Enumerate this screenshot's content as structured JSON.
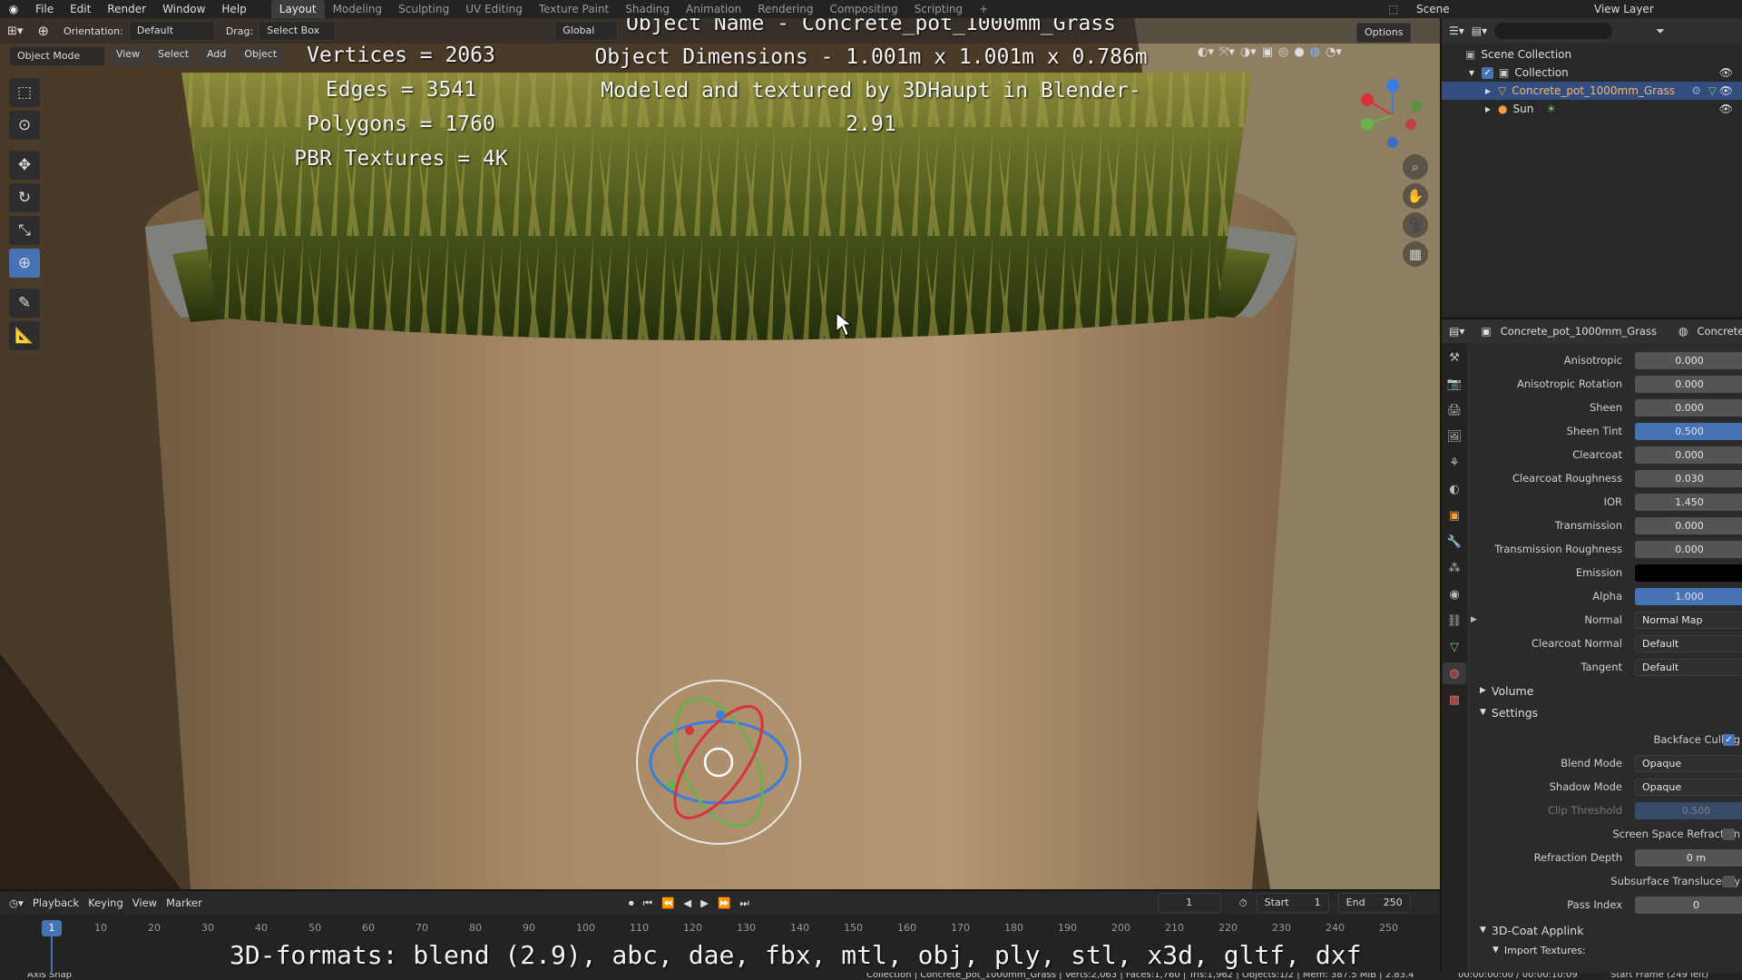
{
  "menu": [
    "File",
    "Edit",
    "Render",
    "Window",
    "Help"
  ],
  "workspaces": [
    "Layout",
    "Modeling",
    "Sculpting",
    "UV Editing",
    "Texture Paint",
    "Shading",
    "Animation",
    "Rendering",
    "Compositing",
    "Scripting"
  ],
  "scene": "Scene",
  "view_layer": "View Layer",
  "viewport": {
    "orientation_label": "Orientation:",
    "orientation": "Default",
    "drag_label": "Drag:",
    "drag": "Select Box",
    "transform": "Global",
    "options": "Options",
    "mode": "Object Mode",
    "view_menu": "View",
    "select_menu": "Select",
    "add_menu": "Add",
    "object_menu": "Object"
  },
  "overlay": {
    "stats": [
      "Vertices = 2063",
      "Edges = 3541",
      "Polygons = 1760",
      "PBR Textures = 4K"
    ],
    "name": "Object Name - Concrete_pot_1000mm_Grass",
    "dims": "Object Dimensions -  1.001m x 1.001m x 0.786m",
    "credit": "Modeled and textured by 3DHaupt in Blender-2.91",
    "formats": "3D-formats: blend (2.9), abc, dae, fbx, mtl, obj, ply, stl, x3d, gltf, dxf"
  },
  "outliner": {
    "root": "Scene Collection",
    "collection": "Collection",
    "object": "Concrete_pot_1000mm_Grass",
    "sun": "Sun"
  },
  "props": {
    "object": "Concrete_pot_1000mm_Grass",
    "material": "Concrete",
    "rows": [
      {
        "label": "Anisotropic",
        "value": "0.000"
      },
      {
        "label": "Anisotropic Rotation",
        "value": "0.000"
      },
      {
        "label": "Sheen",
        "value": "0.000"
      },
      {
        "label": "Sheen Tint",
        "value": "0.500",
        "fill": 0.5
      },
      {
        "label": "Clearcoat",
        "value": "0.000"
      },
      {
        "label": "Clearcoat Roughness",
        "value": "0.030",
        "fill": 0.03
      },
      {
        "label": "IOR",
        "value": "1.450"
      },
      {
        "label": "Transmission",
        "value": "0.000"
      },
      {
        "label": "Transmission Roughness",
        "value": "0.000"
      },
      {
        "label": "Emission",
        "value": ""
      },
      {
        "label": "Alpha",
        "value": "1.000",
        "fill": 1.0
      },
      {
        "label": "Normal",
        "value": "Normal Map"
      },
      {
        "label": "Clearcoat Normal",
        "value": "Default"
      },
      {
        "label": "Tangent",
        "value": "Default"
      }
    ],
    "volume": "Volume",
    "settings": "Settings",
    "backface_culling": "Backface Culling",
    "blend_mode_label": "Blend Mode",
    "blend_mode": "Opaque",
    "shadow_mode_label": "Shadow Mode",
    "shadow_mode": "Opaque",
    "clip_threshold_label": "Clip Threshold",
    "clip_threshold": "0.500",
    "ssr": "Screen Space Refraction",
    "refraction_depth_label": "Refraction Depth",
    "refraction_depth": "0 m",
    "sss": "Subsurface Translucency",
    "pass_index_label": "Pass Index",
    "pass_index": "0",
    "applink": "3D-Coat Applink",
    "import_textures": "Import Textures:"
  },
  "timeline": {
    "playback": "Playback",
    "keying": "Keying",
    "view": "View",
    "marker": "Marker",
    "current": "1",
    "start_label": "Start",
    "start": "1",
    "end_label": "End",
    "end": "250",
    "ticks": [
      "10",
      "20",
      "30",
      "40",
      "50",
      "60",
      "70",
      "80",
      "90",
      "100",
      "110",
      "120",
      "130",
      "140",
      "150",
      "160",
      "170",
      "180",
      "190",
      "200",
      "210",
      "220",
      "230",
      "240",
      "250"
    ]
  },
  "status": {
    "left": "Axis Snap",
    "stats": "Collection | Concrete_pot_1000mm_Grass | Verts:2,063 | Faces:1,760 | Tris:1,962 | Objects:1/2 | Mem: 387.5 MiB | 2.83.4",
    "time": "00:00:00:00 / 00:00:10:09",
    "frame": "Start Frame (249 left)"
  }
}
